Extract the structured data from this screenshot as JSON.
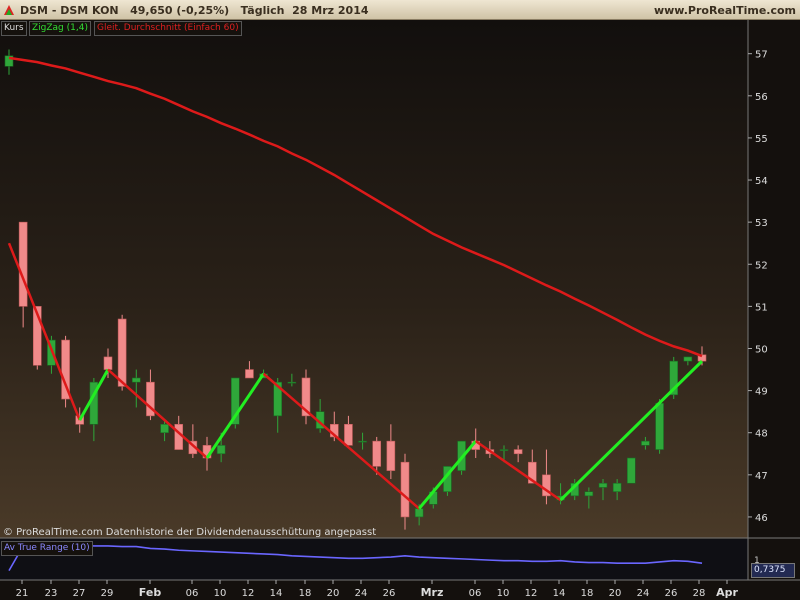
{
  "header": {
    "title": "DSM - DSM KON   49,650 (-0,25%)   Täglich  28 Mrz 2014",
    "site": "www.ProRealTime.com"
  },
  "legend": {
    "kurs": "Kurs",
    "zigzag": "ZigZag (1,4)",
    "ma": "Gleit. Durchschnitt (Einfach 60)"
  },
  "footer_note": "© ProRealTime.com  Datenhistorie der Dividendenausschüttung angepasst",
  "atr": {
    "label": "Av True Range (10)",
    "value": "0,7375",
    "axis_one": "1"
  },
  "colors": {
    "bull": "#2fa73a",
    "bear": "#f08a8a",
    "ma": "#dd1a1a",
    "zigzag": "#22ee22",
    "atr": "#6a66ff"
  },
  "chart_data": [
    {
      "type": "candlestick",
      "ylim": [
        45.5,
        57.8
      ],
      "yticks": [
        "46",
        "47",
        "48",
        "49",
        "50",
        "51",
        "52",
        "53",
        "54",
        "55",
        "56",
        "57"
      ],
      "xtick_labels": [
        "21",
        "23",
        "27",
        "29",
        "Feb",
        "06",
        "10",
        "12",
        "14",
        "18",
        "20",
        "24",
        "26",
        "Mrz",
        "06",
        "10",
        "12",
        "14",
        "18",
        "20",
        "24",
        "26",
        "28",
        "Apr"
      ],
      "candles": [
        {
          "o": 56.7,
          "h": 57.1,
          "l": 56.5,
          "c": 56.95
        },
        {
          "o": 53.0,
          "h": 53.0,
          "l": 50.5,
          "c": 51.0
        },
        {
          "o": 51.0,
          "h": 51.0,
          "l": 49.5,
          "c": 49.6
        },
        {
          "o": 49.6,
          "h": 50.3,
          "l": 49.4,
          "c": 50.2
        },
        {
          "o": 50.2,
          "h": 50.3,
          "l": 48.6,
          "c": 48.8
        },
        {
          "o": 48.4,
          "h": 48.6,
          "l": 48.0,
          "c": 48.2
        },
        {
          "o": 48.2,
          "h": 49.3,
          "l": 47.8,
          "c": 49.2
        },
        {
          "o": 49.8,
          "h": 50.0,
          "l": 49.3,
          "c": 49.5
        },
        {
          "o": 50.7,
          "h": 50.8,
          "l": 49.0,
          "c": 49.1
        },
        {
          "o": 49.2,
          "h": 49.5,
          "l": 48.6,
          "c": 49.3
        },
        {
          "o": 49.2,
          "h": 49.5,
          "l": 48.3,
          "c": 48.4
        },
        {
          "o": 48.0,
          "h": 48.3,
          "l": 47.8,
          "c": 48.2
        },
        {
          "o": 48.2,
          "h": 48.4,
          "l": 47.6,
          "c": 47.6
        },
        {
          "o": 47.8,
          "h": 48.2,
          "l": 47.4,
          "c": 47.5
        },
        {
          "o": 47.7,
          "h": 47.9,
          "l": 47.1,
          "c": 47.4
        },
        {
          "o": 47.5,
          "h": 48.0,
          "l": 47.3,
          "c": 47.7
        },
        {
          "o": 48.2,
          "h": 49.3,
          "l": 48.1,
          "c": 49.3
        },
        {
          "o": 49.5,
          "h": 49.7,
          "l": 49.3,
          "c": 49.3
        },
        {
          "o": 49.3,
          "h": 49.5,
          "l": 49.3,
          "c": 49.4
        },
        {
          "o": 48.4,
          "h": 49.3,
          "l": 48.0,
          "c": 49.2
        },
        {
          "o": 49.2,
          "h": 49.4,
          "l": 49.1,
          "c": 49.2
        },
        {
          "o": 49.3,
          "h": 49.5,
          "l": 48.2,
          "c": 48.4
        },
        {
          "o": 48.1,
          "h": 48.8,
          "l": 48.0,
          "c": 48.5
        },
        {
          "o": 48.2,
          "h": 48.5,
          "l": 47.8,
          "c": 47.9
        },
        {
          "o": 48.2,
          "h": 48.4,
          "l": 47.8,
          "c": 47.7
        },
        {
          "o": 47.8,
          "h": 48.0,
          "l": 47.6,
          "c": 47.8
        },
        {
          "o": 47.8,
          "h": 47.9,
          "l": 47.0,
          "c": 47.2
        },
        {
          "o": 47.8,
          "h": 48.2,
          "l": 46.9,
          "c": 47.1
        },
        {
          "o": 47.3,
          "h": 47.5,
          "l": 45.7,
          "c": 46.0
        },
        {
          "o": 46.0,
          "h": 46.3,
          "l": 45.8,
          "c": 46.2
        },
        {
          "o": 46.3,
          "h": 46.7,
          "l": 46.2,
          "c": 46.6
        },
        {
          "o": 46.6,
          "h": 47.2,
          "l": 46.5,
          "c": 47.2
        },
        {
          "o": 47.1,
          "h": 47.8,
          "l": 47.0,
          "c": 47.8
        },
        {
          "o": 47.8,
          "h": 48.1,
          "l": 47.4,
          "c": 47.6
        },
        {
          "o": 47.6,
          "h": 47.8,
          "l": 47.4,
          "c": 47.5
        },
        {
          "o": 47.6,
          "h": 47.7,
          "l": 47.3,
          "c": 47.6
        },
        {
          "o": 47.6,
          "h": 47.7,
          "l": 47.3,
          "c": 47.5
        },
        {
          "o": 47.3,
          "h": 47.6,
          "l": 46.8,
          "c": 46.8
        },
        {
          "o": 47.0,
          "h": 47.6,
          "l": 46.3,
          "c": 46.5
        },
        {
          "o": 46.4,
          "h": 46.8,
          "l": 46.3,
          "c": 46.5
        },
        {
          "o": 46.5,
          "h": 46.9,
          "l": 46.4,
          "c": 46.8
        },
        {
          "o": 46.5,
          "h": 46.7,
          "l": 46.2,
          "c": 46.6
        },
        {
          "o": 46.7,
          "h": 46.9,
          "l": 46.4,
          "c": 46.8
        },
        {
          "o": 46.6,
          "h": 46.9,
          "l": 46.4,
          "c": 46.8
        },
        {
          "o": 46.8,
          "h": 47.4,
          "l": 46.8,
          "c": 47.4
        },
        {
          "o": 47.7,
          "h": 47.9,
          "l": 47.6,
          "c": 47.8
        },
        {
          "o": 47.6,
          "h": 48.8,
          "l": 47.5,
          "c": 48.7
        },
        {
          "o": 48.9,
          "h": 49.8,
          "l": 48.8,
          "c": 49.7
        },
        {
          "o": 49.7,
          "h": 49.8,
          "l": 49.6,
          "c": 49.8
        },
        {
          "o": 49.85,
          "h": 50.05,
          "l": 49.6,
          "c": 49.7
        }
      ],
      "moving_average": [
        56.9,
        56.85,
        56.8,
        56.72,
        56.65,
        56.55,
        56.45,
        56.35,
        56.27,
        56.18,
        56.05,
        55.93,
        55.78,
        55.63,
        55.5,
        55.35,
        55.22,
        55.08,
        54.93,
        54.8,
        54.63,
        54.48,
        54.3,
        54.12,
        53.92,
        53.72,
        53.52,
        53.32,
        53.12,
        52.92,
        52.72,
        52.56,
        52.4,
        52.26,
        52.12,
        51.98,
        51.82,
        51.66,
        51.5,
        51.35,
        51.18,
        51.02,
        50.85,
        50.68,
        50.5,
        50.33,
        50.18,
        50.05,
        49.95,
        49.82
      ],
      "zigzag": [
        {
          "i": 0,
          "v": 52.5
        },
        {
          "i": 5,
          "v": 48.3
        },
        {
          "i": 7,
          "v": 49.5
        },
        {
          "i": 14,
          "v": 47.4
        },
        {
          "i": 18,
          "v": 49.4
        },
        {
          "i": 29,
          "v": 46.2
        },
        {
          "i": 33,
          "v": 47.8
        },
        {
          "i": 39,
          "v": 46.4
        },
        {
          "i": 49,
          "v": 49.7
        }
      ]
    },
    {
      "type": "line",
      "ylim": [
        0.5,
        1.1
      ],
      "values": [
        0.62,
        1.02,
        1.05,
        1.05,
        1.04,
        1.03,
        1.02,
        1.02,
        1.01,
        1.01,
        0.98,
        0.97,
        0.95,
        0.94,
        0.93,
        0.92,
        0.91,
        0.9,
        0.89,
        0.88,
        0.86,
        0.85,
        0.84,
        0.83,
        0.82,
        0.82,
        0.83,
        0.84,
        0.86,
        0.84,
        0.83,
        0.82,
        0.81,
        0.8,
        0.79,
        0.78,
        0.78,
        0.77,
        0.77,
        0.78,
        0.76,
        0.75,
        0.75,
        0.74,
        0.74,
        0.74,
        0.76,
        0.78,
        0.77,
        0.74
      ]
    }
  ]
}
